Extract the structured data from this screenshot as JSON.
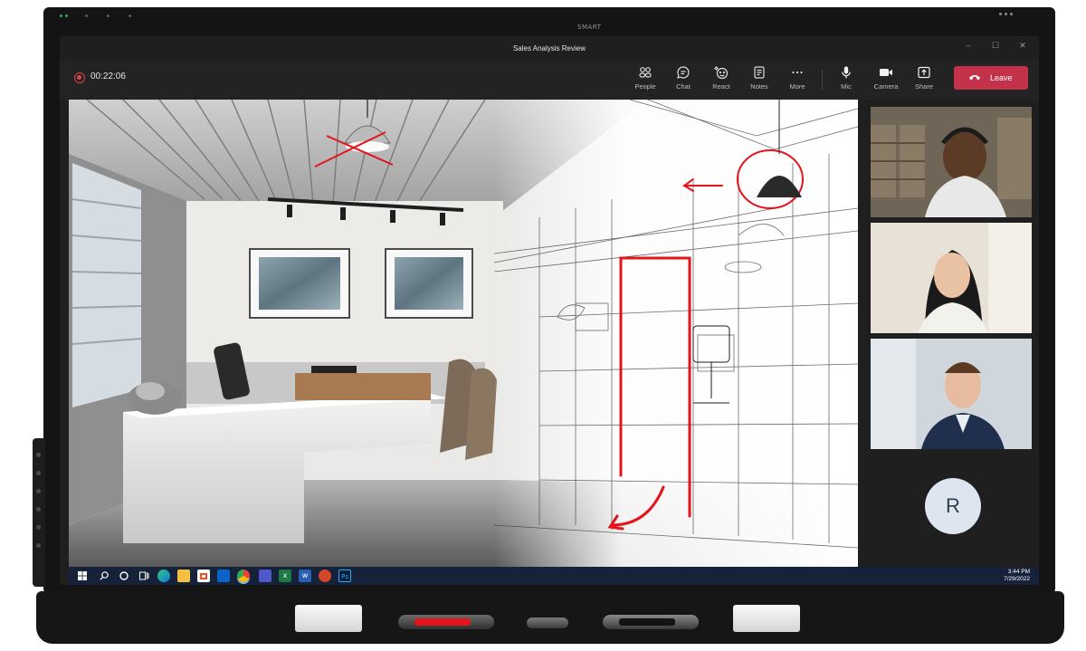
{
  "device": {
    "brand_label": "SMART"
  },
  "window": {
    "title": "Sales Analysis Review",
    "minimize": "–",
    "maximize": "☐",
    "close": "✕"
  },
  "meeting": {
    "recording_timer": "00:22:06"
  },
  "toolbar": {
    "buttons": [
      {
        "label": "People",
        "icon": "people-icon"
      },
      {
        "label": "Chat",
        "icon": "chat-icon"
      },
      {
        "label": "React",
        "icon": "react-icon"
      },
      {
        "label": "Notes",
        "icon": "notes-icon"
      },
      {
        "label": "More",
        "icon": "more-icon"
      },
      {
        "label": "Mic",
        "icon": "mic-icon"
      },
      {
        "label": "Camera",
        "icon": "camera-icon"
      },
      {
        "label": "Share",
        "icon": "share-icon"
      }
    ],
    "leave_label": "Leave",
    "leave_color": "#c4314b"
  },
  "gallery": {
    "participants": [
      {
        "kind": "video",
        "icon": "participant-video"
      },
      {
        "kind": "video",
        "icon": "participant-video"
      },
      {
        "kind": "video",
        "icon": "participant-video"
      },
      {
        "kind": "avatar",
        "initial": "R"
      }
    ]
  },
  "taskbar": {
    "time": "3:44 PM",
    "date": "7/29/2022",
    "apps": [
      "windows-start-icon",
      "search-icon",
      "cortana-icon",
      "task-view-icon",
      "edge-icon",
      "file-explorer-icon",
      "store-icon",
      "outlook-icon",
      "chrome-icon",
      "teams-icon",
      "excel-icon",
      "word-icon",
      "powerpoint-icon",
      "photoshop-icon"
    ],
    "app_labels": {
      "excel": "x",
      "word": "w",
      "photoshop": "Ps"
    }
  },
  "colors": {
    "taskbar": "#16223a",
    "annotation": "#e3141c",
    "recording": "#e2434f"
  }
}
